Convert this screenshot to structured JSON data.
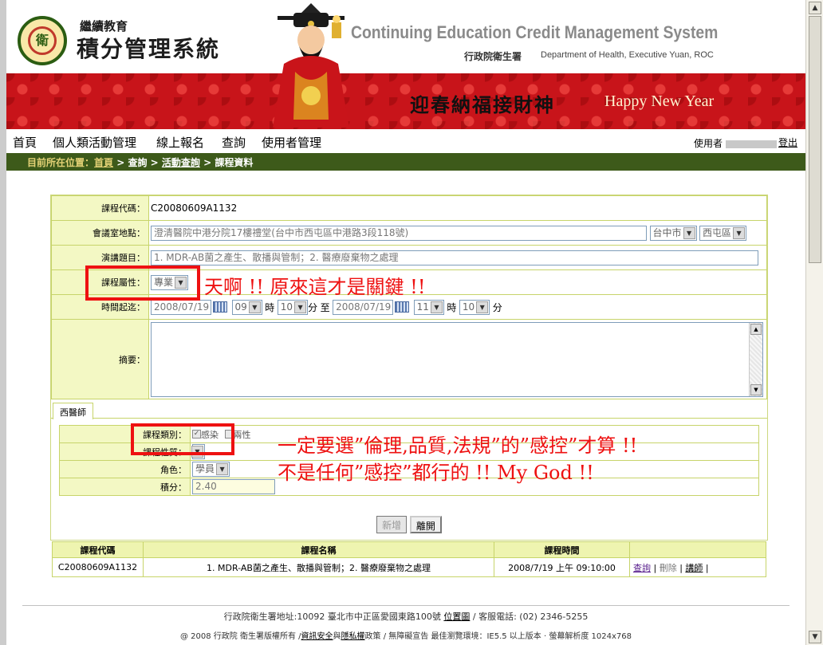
{
  "header": {
    "logo_small": "繼續教育",
    "logo_big": "積分管理系統",
    "title_en": "Continuing Education Credit Management System",
    "dept_zh": "行政院衛生署",
    "dept_en": "Department of Health, Executive Yuan, ROC",
    "banner_zh": "迎春納福接財神",
    "banner_en": "Happy New Year"
  },
  "menu": {
    "items": [
      "首頁",
      "個人類活動管理",
      "線上報名",
      "查詢",
      "使用者管理"
    ],
    "user_label": "使用者",
    "logout": "登出"
  },
  "breadcrumb": {
    "label": "目前所在位置：",
    "home": "首頁",
    "sep": " > ",
    "query": "查詢",
    "activity": "活動查詢",
    "current": "課程資料"
  },
  "form": {
    "code_label": "課程代碼：",
    "code_value": "C20080609A1132",
    "venue_label": "會議室地點：",
    "venue_value": "澄清醫院中港分院17樓禮堂(台中市西屯區中港路3段118號)",
    "city": "台中市",
    "district": "西屯區",
    "topic_label": "演講題目：",
    "topic_value": "1. MDR-AB菌之產生、散播與管制；2. 醫療廢棄物之處理",
    "attr_label": "課程屬性：",
    "attr_value": "專業",
    "time_label": "時間起迄：",
    "start_date": "2008/07/19",
    "start_hour": "09",
    "start_min": "10",
    "end_date": "2008/07/19",
    "end_hour": "11",
    "end_min": "10",
    "hour_unit": "時",
    "min_unit": "分",
    "to": "至",
    "summary_label": "摘要：",
    "tab": "西醫師",
    "category_label": "課程類別：",
    "cat_option1": "感染",
    "cat_option2": "兩性",
    "nature_label": "課程性質：",
    "role_label": "角色：",
    "role_value": "學員",
    "credit_label": "積分：",
    "credit_value": "2.40",
    "btn_add": "新增",
    "btn_leave": "離開"
  },
  "result": {
    "headers": [
      "課程代碼",
      "課程名稱",
      "課程時間",
      ""
    ],
    "row": {
      "code": "C20080609A1132",
      "name": "1. MDR-AB菌之產生、散播與管制；2. 醫療廢棄物之處理",
      "time": "2008/7/19 上午 09:10:00",
      "action_query": "查詢",
      "action_delete": "刪除",
      "action_lecturer": "講師"
    }
  },
  "footer": {
    "line1_text": "行政院衛生署地址:10092 臺北市中正區愛國東路100號",
    "map_link": "位置圖",
    "line1_tail": "/ 客服電話: (02) 2346-5255",
    "line2_head": "@ 2008 行政院 衛生署版權所有 /",
    "security_link": "資訊安全",
    "and": "與",
    "privacy_link": "隱私權",
    "line2_tail": "政策 / 無障礙宣告 最佳瀏覽環境：IE5.5 以上版本 ·   螢幕解析度 1024x768"
  },
  "annotations": {
    "note1": "天啊 !! 原來這才是關鍵 !!",
    "note2_line1": "一定要選”倫理,品質,法規”的”感控”才算 !!",
    "note2_line2": "不是任何”感控”都行的 !! My God !!"
  },
  "colors": {
    "banner_red": "#c8141a",
    "breadcrumb_green": "#3d5a1a",
    "label_bg": "#f3f8c4",
    "annotation_red": "#ee1111"
  }
}
